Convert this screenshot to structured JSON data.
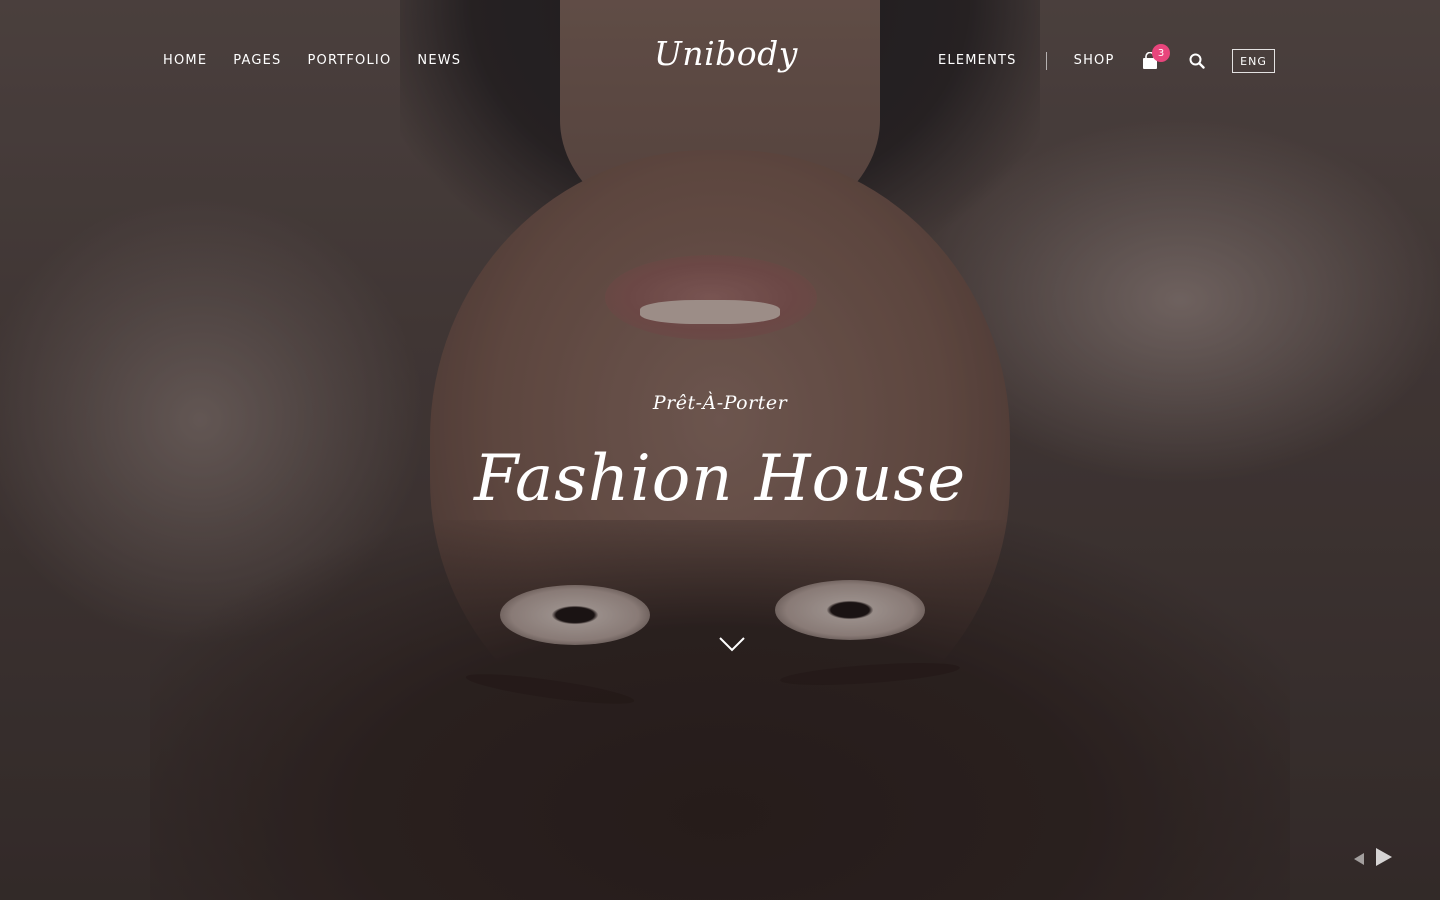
{
  "nav": {
    "left_items": [
      {
        "label": "HOME"
      },
      {
        "label": "PAGES"
      },
      {
        "label": "PORTFOLIO"
      },
      {
        "label": "NEWS"
      }
    ],
    "right_items": [
      {
        "label": "ELEMENTS"
      },
      {
        "label": "SHOP"
      }
    ]
  },
  "logo": {
    "text": "Unibody"
  },
  "cart": {
    "icon": "shopping-bag-icon",
    "count": "3",
    "badge_color": "#e8457c"
  },
  "search": {
    "icon": "search-icon"
  },
  "language": {
    "label": "ENG"
  },
  "hero": {
    "subtitle": "Prêt-À-Porter",
    "title": "Fashion House",
    "scroll_icon": "chevron-down-icon"
  },
  "slider": {
    "prev_icon": "triangle-left-icon",
    "next_icon": "triangle-right-icon"
  }
}
